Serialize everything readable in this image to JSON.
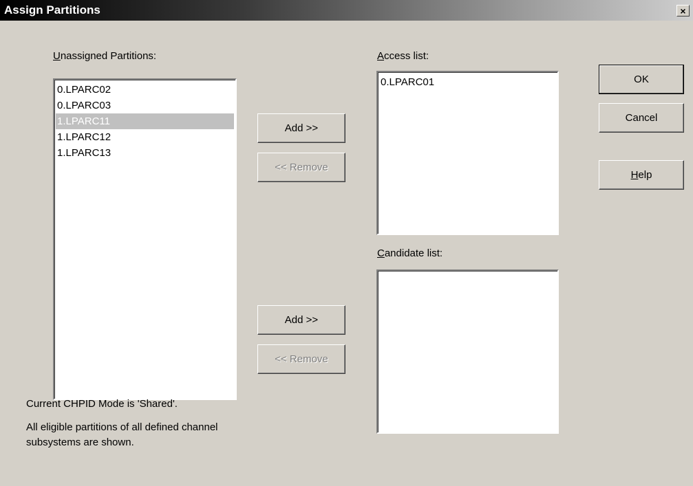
{
  "window": {
    "title": "Assign Partitions",
    "close_label": "×"
  },
  "unassigned": {
    "label_mnemonic": "U",
    "label_rest": "nassigned Partitions:",
    "items": [
      {
        "label": "0.LPARC02",
        "selected": false
      },
      {
        "label": "0.LPARC03",
        "selected": false
      },
      {
        "label": "1.LPARC11",
        "selected": true
      },
      {
        "label": "1.LPARC12",
        "selected": false
      },
      {
        "label": "1.LPARC13",
        "selected": false
      }
    ]
  },
  "access": {
    "label_mnemonic": "A",
    "label_rest": "ccess list:",
    "items": [
      {
        "label": "0.LPARC01",
        "selected": false
      }
    ]
  },
  "candidate": {
    "label_mnemonic": "C",
    "label_rest": "andidate list:",
    "items": []
  },
  "buttons": {
    "add_access": "Add >>",
    "remove_access": "<< Remove",
    "add_candidate": "Add >>",
    "remove_candidate": "<< Remove",
    "ok": "OK",
    "cancel": "Cancel",
    "help_mnemonic": "H",
    "help_rest": "elp"
  },
  "notes": {
    "mode": "Current CHPID Mode is 'Shared'.",
    "eligible_line1": "All eligible partitions of all defined channel",
    "eligible_line2": "subsystems are shown."
  }
}
